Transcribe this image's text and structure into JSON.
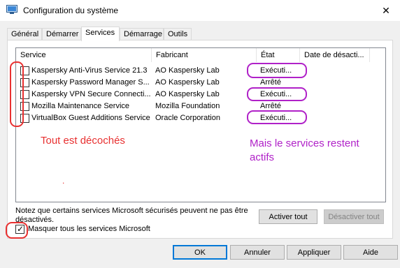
{
  "window": {
    "title": "Configuration du système",
    "close_symbol": "✕"
  },
  "tabs": [
    {
      "label": "Général"
    },
    {
      "label": "Démarrer"
    },
    {
      "label": "Services",
      "active": true
    },
    {
      "label": "Démarrage"
    },
    {
      "label": "Outils"
    }
  ],
  "services_table": {
    "columns": [
      "Service",
      "Fabricant",
      "État",
      "Date de désacti..."
    ],
    "rows": [
      {
        "service": "Kaspersky Anti-Virus Service 21.3",
        "fabricant": "AO Kaspersky Lab",
        "etat": "Exécuti...",
        "checked": false
      },
      {
        "service": "Kaspersky Password Manager S...",
        "fabricant": "AO Kaspersky Lab",
        "etat": "Arrêté",
        "checked": false
      },
      {
        "service": "Kaspersky VPN Secure Connecti...",
        "fabricant": "AO Kaspersky Lab",
        "etat": "Exécuti...",
        "checked": false
      },
      {
        "service": "Mozilla Maintenance Service",
        "fabricant": "Mozilla Foundation",
        "etat": "Arrêté",
        "checked": false
      },
      {
        "service": "VirtualBox Guest Additions Service",
        "fabricant": "Oracle Corporation",
        "etat": "Exécuti...",
        "checked": false
      }
    ]
  },
  "annotations": {
    "unchecked_note": "Tout est décochés",
    "dot": ".",
    "running_note_line1": "Mais le services restent",
    "running_note_line2": "actifs",
    "red_color": "#e83030",
    "purple_color": "#b021c8"
  },
  "note": "Notez que certains services Microsoft sécurisés peuvent ne pas être désactivés.",
  "buttons": {
    "enable_all": "Activer tout",
    "disable_all": "Désactiver tout",
    "ok": "OK",
    "cancel": "Annuler",
    "apply": "Appliquer",
    "help": "Aide"
  },
  "hide_ms": {
    "label": "Masquer tous les services Microsoft",
    "checked": true,
    "check_symbol": "✓"
  },
  "colors": {
    "accent": "#0078d7"
  }
}
